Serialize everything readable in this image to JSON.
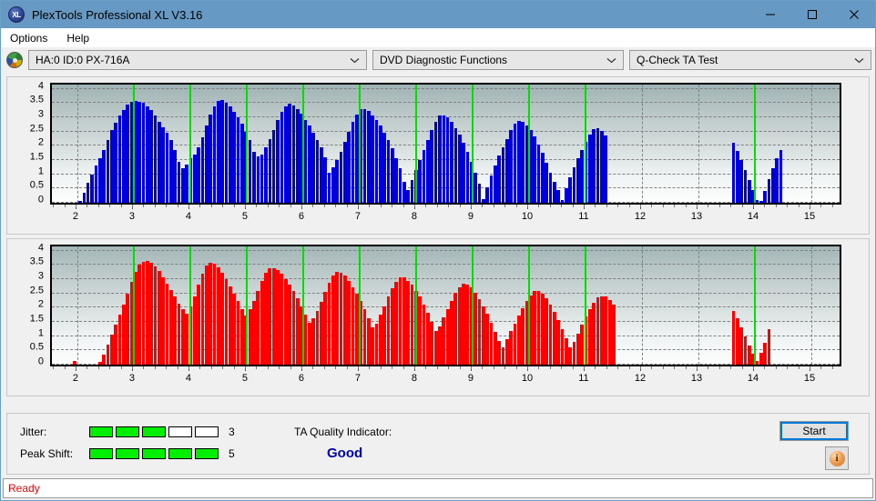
{
  "window": {
    "title": "PlexTools Professional XL V3.16",
    "app_icon": "xl-logo-icon",
    "minimize": "minimize-icon",
    "maximize": "maximize-icon",
    "close": "close-icon",
    "titlebar_color": "#6699c3"
  },
  "menubar": {
    "items": [
      {
        "label": "Options"
      },
      {
        "label": "Help"
      }
    ]
  },
  "toolbar": {
    "drive_icon": "optical-disc-icon",
    "drive_select": {
      "value": "HA:0 ID:0  PX-716A"
    },
    "function_select": {
      "value": "DVD Diagnostic Functions"
    },
    "test_select": {
      "value": "Q-Check TA Test"
    }
  },
  "status_panel": {
    "jitter": {
      "label": "Jitter:",
      "value": "3",
      "filled": 3,
      "total": 5
    },
    "peak_shift": {
      "label": "Peak Shift:",
      "value": "5",
      "filled": 5,
      "total": 5
    },
    "ta_quality": {
      "label": "TA Quality Indicator:",
      "value": "Good",
      "color": "#0000b4"
    },
    "start_button": "Start",
    "info_button": "info-icon"
  },
  "statusbar": {
    "text": "Ready",
    "color": "#ff0000"
  },
  "chart_data": [
    {
      "type": "bar",
      "title": "Jitter",
      "series_color": "#0000dd",
      "xlabel": "",
      "ylabel": "",
      "xlim": [
        1.55,
        15.5
      ],
      "ylim": [
        0,
        4.15
      ],
      "yticks": [
        0,
        0.5,
        1,
        1.5,
        2,
        2.5,
        3,
        3.5,
        4
      ],
      "ytick_labels": [
        "0",
        "0.5",
        "1",
        "1.5",
        "2",
        "2.5",
        "3",
        "3.5",
        "4"
      ],
      "xticks": [
        2,
        3,
        4,
        5,
        6,
        7,
        8,
        9,
        10,
        11,
        12,
        13,
        14,
        15
      ],
      "xtick_labels": [
        "2",
        "3",
        "4",
        "5",
        "6",
        "7",
        "8",
        "9",
        "10",
        "11",
        "12",
        "13",
        "14",
        "15"
      ],
      "grid": true,
      "markers": [
        3,
        4,
        5,
        6,
        7,
        8,
        9,
        10,
        11,
        14
      ],
      "marker_color": "#00e000",
      "x": [
        2.05,
        2.12,
        2.19,
        2.26,
        2.33,
        2.4,
        2.47,
        2.54,
        2.61,
        2.68,
        2.75,
        2.82,
        2.89,
        2.96,
        3.03,
        3.1,
        3.17,
        3.24,
        3.31,
        3.38,
        3.45,
        3.52,
        3.59,
        3.66,
        3.73,
        3.8,
        3.87,
        3.94,
        4.01,
        4.08,
        4.15,
        4.22,
        4.29,
        4.36,
        4.43,
        4.5,
        4.57,
        4.64,
        4.71,
        4.78,
        4.85,
        4.92,
        4.99,
        5.06,
        5.13,
        5.2,
        5.27,
        5.34,
        5.41,
        5.48,
        5.55,
        5.62,
        5.69,
        5.76,
        5.83,
        5.9,
        5.97,
        6.04,
        6.11,
        6.18,
        6.25,
        6.32,
        6.39,
        6.46,
        6.53,
        6.6,
        6.67,
        6.74,
        6.81,
        6.88,
        6.95,
        7.02,
        7.09,
        7.16,
        7.23,
        7.3,
        7.37,
        7.44,
        7.51,
        7.58,
        7.65,
        7.72,
        7.79,
        7.86,
        7.93,
        8.0,
        8.07,
        8.14,
        8.21,
        8.28,
        8.35,
        8.42,
        8.49,
        8.56,
        8.63,
        8.7,
        8.77,
        8.84,
        8.91,
        8.98,
        9.05,
        9.12,
        9.19,
        9.26,
        9.33,
        9.4,
        9.47,
        9.54,
        9.61,
        9.68,
        9.75,
        9.82,
        9.89,
        9.96,
        10.03,
        10.1,
        10.17,
        10.24,
        10.31,
        10.38,
        10.45,
        10.52,
        10.59,
        10.66,
        10.73,
        10.8,
        10.87,
        10.94,
        11.01,
        11.08,
        11.15,
        11.22,
        11.29,
        11.36,
        13.62,
        13.69,
        13.76,
        13.83,
        13.9,
        13.97,
        14.04,
        14.11,
        14.18,
        14.25,
        14.32,
        14.39,
        14.46
      ],
      "values": [
        0.05,
        0.35,
        0.7,
        1.0,
        1.3,
        1.55,
        1.85,
        2.2,
        2.55,
        2.8,
        3.05,
        3.25,
        3.45,
        3.55,
        3.58,
        3.55,
        3.5,
        3.4,
        3.25,
        3.05,
        2.85,
        2.65,
        2.45,
        2.2,
        1.85,
        1.45,
        1.2,
        1.35,
        1.55,
        1.7,
        1.95,
        2.3,
        2.7,
        3.1,
        3.4,
        3.58,
        3.6,
        3.52,
        3.38,
        3.18,
        3.0,
        2.78,
        2.5,
        2.2,
        1.8,
        1.62,
        1.7,
        1.95,
        2.25,
        2.55,
        2.9,
        3.2,
        3.4,
        3.48,
        3.42,
        3.3,
        3.12,
        2.9,
        2.7,
        2.45,
        2.2,
        1.95,
        1.6,
        1.05,
        1.25,
        1.5,
        1.8,
        2.15,
        2.5,
        2.85,
        3.1,
        3.28,
        3.3,
        3.22,
        3.08,
        2.9,
        2.7,
        2.45,
        2.2,
        1.92,
        1.58,
        1.2,
        0.72,
        0.45,
        0.8,
        1.15,
        1.5,
        1.85,
        2.2,
        2.55,
        2.85,
        3.05,
        3.08,
        3.0,
        2.85,
        2.62,
        2.38,
        2.1,
        1.8,
        1.45,
        1.05,
        0.68,
        0.12,
        0.55,
        0.95,
        1.3,
        1.65,
        1.95,
        2.25,
        2.55,
        2.78,
        2.88,
        2.84,
        2.72,
        2.55,
        2.32,
        2.05,
        1.75,
        1.4,
        1.05,
        0.75,
        0.45,
        0.1,
        0.52,
        0.9,
        1.25,
        1.55,
        1.85,
        2.15,
        2.4,
        2.58,
        2.62,
        2.52,
        2.35,
        2.12,
        1.82,
        1.5,
        1.15,
        0.8,
        0.45,
        0.1,
        0.05,
        0.4,
        0.82,
        1.2,
        1.55,
        1.85,
        2.1,
        2.28,
        2.38,
        2.36,
        2.25,
        2.05,
        1.8,
        1.5,
        1.18,
        0.82,
        0.45,
        0.1,
        0.05,
        0.02,
        0.02,
        0.3,
        0.62,
        0.9,
        1.15,
        1.4,
        1.6,
        1.72,
        1.78,
        1.7,
        1.58,
        1.52,
        1.55,
        1.4,
        1.2,
        0.92,
        0.6,
        0.25,
        0.32,
        0.02,
        0.02,
        0.02,
        0.02,
        1.0,
        1.25,
        1.48,
        1.55,
        1.7,
        1.8,
        1.82,
        1.75,
        1.62,
        1.45,
        1.25,
        1.0,
        0.7,
        0.35
      ]
    },
    {
      "type": "bar",
      "title": "Peak Shift",
      "series_color": "#ff0000",
      "xlabel": "",
      "ylabel": "",
      "xlim": [
        1.55,
        15.5
      ],
      "ylim": [
        0,
        4.15
      ],
      "yticks": [
        0,
        0.5,
        1,
        1.5,
        2,
        2.5,
        3,
        3.5,
        4
      ],
      "ytick_labels": [
        "0",
        "0.5",
        "1",
        "1.5",
        "2",
        "2.5",
        "3",
        "3.5",
        "4"
      ],
      "xticks": [
        2,
        3,
        4,
        5,
        6,
        7,
        8,
        9,
        10,
        11,
        12,
        13,
        14,
        15
      ],
      "xtick_labels": [
        "2",
        "3",
        "4",
        "5",
        "6",
        "7",
        "8",
        "9",
        "10",
        "11",
        "12",
        "13",
        "14",
        "15"
      ],
      "grid": true,
      "markers": [
        3,
        4,
        5,
        6,
        7,
        8,
        9,
        10,
        11,
        14
      ],
      "marker_color": "#00e000",
      "x": [
        1.95,
        2.4,
        2.47,
        2.54,
        2.61,
        2.68,
        2.75,
        2.82,
        2.89,
        2.96,
        3.03,
        3.1,
        3.17,
        3.24,
        3.31,
        3.38,
        3.45,
        3.52,
        3.59,
        3.66,
        3.73,
        3.8,
        3.87,
        3.94,
        4.01,
        4.08,
        4.15,
        4.22,
        4.29,
        4.36,
        4.43,
        4.5,
        4.57,
        4.64,
        4.71,
        4.78,
        4.85,
        4.92,
        4.99,
        5.06,
        5.13,
        5.2,
        5.27,
        5.34,
        5.41,
        5.48,
        5.55,
        5.62,
        5.69,
        5.76,
        5.83,
        5.9,
        5.97,
        6.04,
        6.11,
        6.18,
        6.25,
        6.32,
        6.39,
        6.46,
        6.53,
        6.6,
        6.67,
        6.74,
        6.81,
        6.88,
        6.95,
        7.02,
        7.09,
        7.16,
        7.23,
        7.3,
        7.37,
        7.44,
        7.51,
        7.58,
        7.65,
        7.72,
        7.79,
        7.86,
        7.93,
        8.0,
        8.07,
        8.14,
        8.21,
        8.28,
        8.35,
        8.42,
        8.49,
        8.56,
        8.63,
        8.7,
        8.77,
        8.84,
        8.91,
        8.98,
        9.05,
        9.12,
        9.19,
        9.26,
        9.33,
        9.4,
        9.47,
        9.54,
        9.61,
        9.68,
        9.75,
        9.82,
        9.89,
        9.96,
        10.03,
        10.1,
        10.17,
        10.24,
        10.31,
        10.38,
        10.45,
        10.52,
        10.59,
        10.66,
        10.73,
        10.8,
        10.87,
        10.94,
        11.01,
        11.08,
        11.15,
        11.22,
        11.29,
        11.36,
        11.43,
        11.5,
        13.62,
        13.69,
        13.76,
        13.83,
        13.9,
        13.97,
        14.04,
        14.11,
        14.18,
        14.25
      ],
      "values": [
        0.12,
        0.1,
        0.35,
        0.7,
        1.05,
        1.4,
        1.75,
        2.1,
        2.5,
        2.9,
        3.25,
        3.5,
        3.62,
        3.65,
        3.58,
        3.45,
        3.28,
        3.08,
        2.85,
        2.62,
        2.38,
        2.15,
        1.95,
        1.78,
        2.05,
        2.4,
        2.8,
        3.2,
        3.48,
        3.58,
        3.55,
        3.42,
        3.22,
        3.0,
        2.75,
        2.5,
        2.25,
        1.95,
        1.72,
        1.95,
        2.25,
        2.6,
        2.95,
        3.22,
        3.38,
        3.4,
        3.32,
        3.18,
        3.0,
        2.8,
        2.58,
        2.32,
        2.05,
        1.75,
        1.48,
        1.62,
        1.88,
        2.2,
        2.55,
        2.88,
        3.12,
        3.25,
        3.22,
        3.12,
        2.95,
        2.72,
        2.5,
        2.25,
        1.95,
        1.62,
        1.3,
        1.45,
        1.75,
        2.05,
        2.38,
        2.68,
        2.92,
        3.05,
        3.05,
        2.95,
        2.8,
        2.6,
        2.38,
        2.12,
        1.82,
        1.5,
        1.18,
        1.35,
        1.65,
        1.95,
        2.25,
        2.52,
        2.72,
        2.85,
        2.82,
        2.7,
        2.52,
        2.3,
        2.05,
        1.78,
        1.48,
        1.15,
        0.82,
        0.62,
        0.88,
        1.18,
        1.45,
        1.72,
        1.98,
        2.22,
        2.42,
        2.58,
        2.6,
        2.5,
        2.32,
        2.1,
        1.85,
        1.55,
        1.25,
        0.92,
        0.62,
        0.8,
        1.1,
        1.4,
        1.68,
        1.95,
        2.18,
        2.35,
        2.4,
        2.38,
        2.28,
        2.1,
        1.88,
        1.62,
        1.32,
        1.0,
        0.68,
        0.38,
        0.12,
        0.4,
        0.78,
        1.25,
        1.52,
        1.62,
        1.75,
        1.78,
        1.68,
        1.55,
        1.58,
        1.35,
        0.72,
        0.8,
        1.05,
        1.45,
        1.75,
        1.82,
        1.7,
        1.55,
        1.3,
        0.88
      ]
    }
  ]
}
